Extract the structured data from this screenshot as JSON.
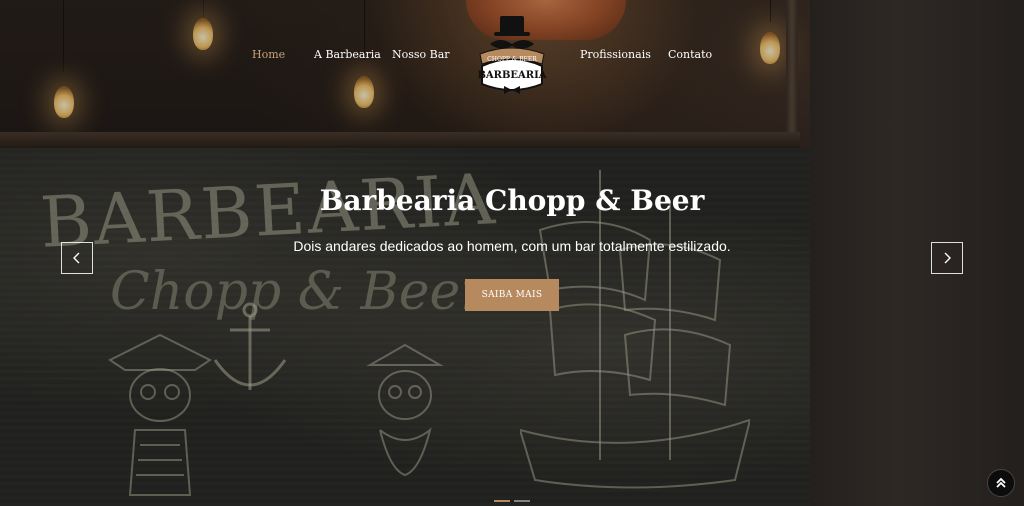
{
  "nav": {
    "items": [
      {
        "label": "Home",
        "active": true
      },
      {
        "label": "A Barbearia",
        "active": false
      },
      {
        "label": "Nosso Bar",
        "active": false
      },
      {
        "label": "Profissionais",
        "active": false
      },
      {
        "label": "Contato",
        "active": false
      }
    ],
    "logo": {
      "top_text": "CHOPP & BEER",
      "main_text": "BARBEARIA"
    }
  },
  "hero": {
    "title": "Barbearia Chopp & Beer",
    "subtitle": "Dois andares dedicados ao homem, com um bar totalmente estilizado.",
    "cta_label": "SAIBA MAIS"
  },
  "carousel": {
    "prev_icon": "chevron-left-icon",
    "next_icon": "chevron-right-icon",
    "slides": 2,
    "active_slide": 1
  },
  "scroll_top_icon": "double-chevron-up-icon",
  "colors": {
    "accent": "#b7895f",
    "active_nav": "#c9a27a",
    "text": "#ffffff"
  }
}
